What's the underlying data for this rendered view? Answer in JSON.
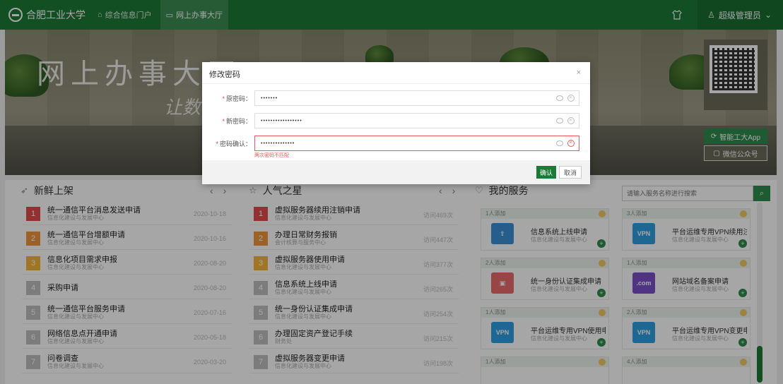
{
  "header": {
    "logo_text": "合肥工业大学",
    "nav": [
      {
        "label": "综合信息门户",
        "icon": "home-icon"
      },
      {
        "label": "网上办事大厅",
        "icon": "monitor-icon"
      }
    ],
    "user_name": "超级管理员",
    "theme_icon": "shirt-icon"
  },
  "banner": {
    "title": "网上办事大厅",
    "subtitle": "让数",
    "app_button": "智能工大App",
    "wechat_button": "微信公众号"
  },
  "panels": {
    "new": {
      "title": "新鲜上架",
      "icon": "send-icon",
      "items": [
        {
          "num": "1",
          "title": "统一通信平台消息发送申请",
          "dept": "信息化建设与发展中心",
          "date": "2020-10-18"
        },
        {
          "num": "2",
          "title": "统一通信平台增额申请",
          "dept": "信息化建设与发展中心",
          "date": "2020-10-16"
        },
        {
          "num": "3",
          "title": "信息化项目需求申报",
          "dept": "信息化建设与发展中心",
          "date": "2020-08-20"
        },
        {
          "num": "4",
          "title": "采购申请",
          "dept": "",
          "date": "2020-08-20"
        },
        {
          "num": "5",
          "title": "统一通信平台服务申请",
          "dept": "信息化建设与发展中心",
          "date": "2020-07-16"
        },
        {
          "num": "6",
          "title": "网络信息点开通申请",
          "dept": "信息化建设与发展中心",
          "date": "2020-05-18"
        },
        {
          "num": "7",
          "title": "问卷调查",
          "dept": "信息化建设与发展中心",
          "date": "2020-03-20"
        }
      ]
    },
    "hot": {
      "title": "人气之星",
      "icon": "star-icon",
      "items": [
        {
          "num": "1",
          "title": "虚拟服务器续用注销申请",
          "dept": "信息化建设与发展中心",
          "count": "访问469次"
        },
        {
          "num": "2",
          "title": "办理日常财务报销",
          "dept": "会计核算与服务中心",
          "count": "访问447次"
        },
        {
          "num": "3",
          "title": "虚拟服务器使用申请",
          "dept": "信息化建设与发展中心",
          "count": "访问377次"
        },
        {
          "num": "4",
          "title": "信息系统上线申请",
          "dept": "信息化建设与发展中心",
          "count": "访问265次"
        },
        {
          "num": "5",
          "title": "统一身份认证集成申请",
          "dept": "信息化建设与发展中心",
          "count": "访问254次"
        },
        {
          "num": "6",
          "title": "办理固定资产登记手续",
          "dept": "财务处",
          "count": "访问215次"
        },
        {
          "num": "7",
          "title": "虚拟服务器变更申请",
          "dept": "信息化建设与发展中心",
          "count": "访问198次"
        }
      ]
    },
    "services": {
      "title": "我的服务",
      "icon": "heart-icon",
      "search_placeholder": "请输入服务名称进行搜索",
      "cards": [
        {
          "added": "1人添加",
          "name": "信息系统上线申请",
          "dept": "信息化建设与发展中心",
          "icon": "monitor-upload-icon",
          "color": "#3a8fd6"
        },
        {
          "added": "3人添加",
          "name": "平台运维专用VPN续用注...",
          "dept": "信息化建设与发展中心",
          "icon": "vpn-icon",
          "color": "#2f9ee0"
        },
        {
          "added": "2人添加",
          "name": "统一身份认证集成申请",
          "dept": "信息化建设与发展中心",
          "icon": "id-badge-icon",
          "color": "#e86a6a"
        },
        {
          "added": "1人添加",
          "name": "网站域名备案申请",
          "dept": "信息化建设与发展中心",
          "icon": "domain-com-icon",
          "color": "#7b4fc9"
        },
        {
          "added": "1人添加",
          "name": "平台运维专用VPN使用申请",
          "dept": "信息化建设与发展中心",
          "icon": "vpn-icon",
          "color": "#2f9ee0"
        },
        {
          "added": "2人添加",
          "name": "平台运维专用VPN变更申请",
          "dept": "信息化建设与发展中心",
          "icon": "vpn-icon",
          "color": "#2f9ee0"
        },
        {
          "added": "1人添加",
          "name": "",
          "dept": "",
          "icon": "",
          "color": "#ffffff"
        },
        {
          "added": "4人添加",
          "name": "",
          "dept": "",
          "icon": "",
          "color": "#ffffff"
        }
      ]
    }
  },
  "modal": {
    "title": "修改密码",
    "fields": [
      {
        "label": "原密码：",
        "value": "•••••••",
        "error": false
      },
      {
        "label": "新密码：",
        "value": "•••••••••••••••••",
        "error": false
      },
      {
        "label": "密码确认：",
        "value": "••••••••••••••",
        "error": true
      }
    ],
    "error_text": "两次密码不匹配",
    "ok": "确认",
    "cancel": "取消"
  },
  "colors": {
    "brand": "#1c7a37",
    "error": "#e85a5a",
    "rank1": "#e24a4a",
    "rank2": "#f0953c",
    "rank3": "#f3b63a",
    "rank_other": "#bfbfbf"
  }
}
